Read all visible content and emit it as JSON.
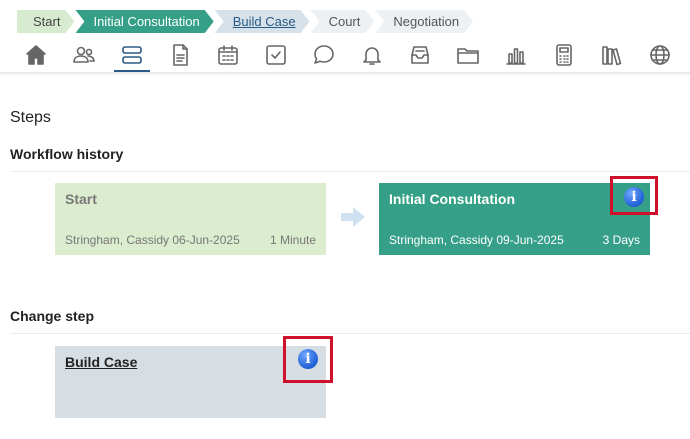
{
  "breadcrumb": {
    "items": [
      {
        "label": "Start",
        "state": "done"
      },
      {
        "label": "Initial Consultation",
        "state": "active"
      },
      {
        "label": "Build Case",
        "state": "next"
      },
      {
        "label": "Court",
        "state": "future"
      },
      {
        "label": "Negotiation",
        "state": "future"
      }
    ]
  },
  "toolbar": {
    "icons": [
      "home-icon",
      "people-icon",
      "steps-icon",
      "document-icon",
      "calendar-icon",
      "checkbox-icon",
      "chat-icon",
      "bell-icon",
      "inbox-icon",
      "folder-icon",
      "bar-chart-icon",
      "calculator-icon",
      "books-icon",
      "globe-icon"
    ],
    "active": "steps-icon"
  },
  "page": {
    "title": "Steps",
    "workflow_history_heading": "Workflow history",
    "change_step_heading": "Change step"
  },
  "history": {
    "start": {
      "title": "Start",
      "person_date": "Stringham, Cassidy 06-Jun-2025",
      "duration": "1 Minute"
    },
    "current": {
      "title": "Initial Consultation",
      "person_date": "Stringham, Cassidy 09-Jun-2025",
      "duration": "3 Days"
    }
  },
  "change_step": {
    "title": "Build Case"
  },
  "colors": {
    "accent": "#35a087",
    "done": "#dbeccf",
    "link": "#2a5b86",
    "highlight": "#d0112b"
  }
}
